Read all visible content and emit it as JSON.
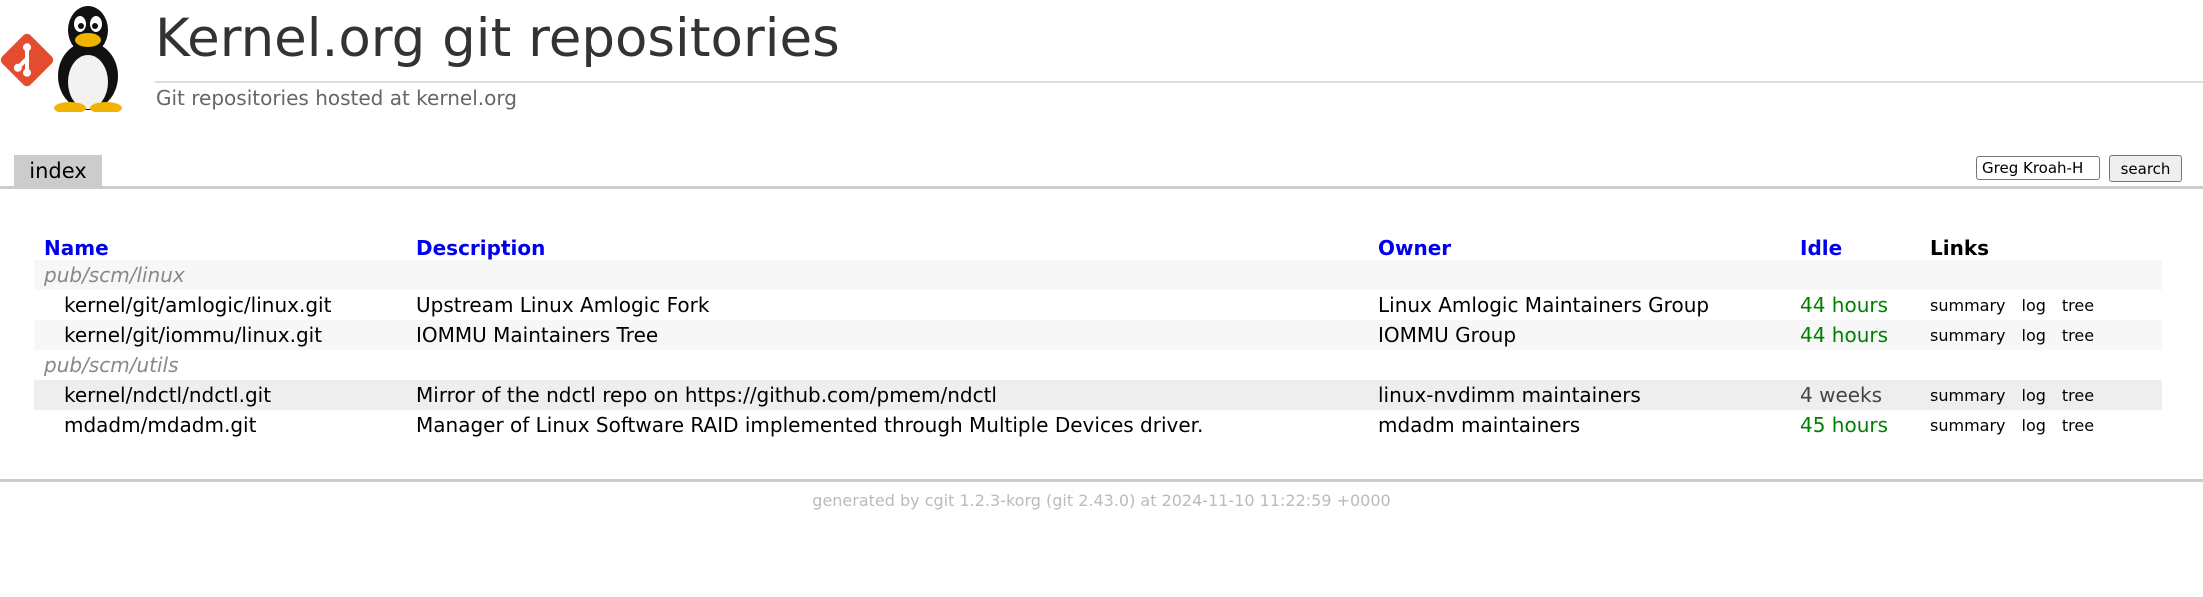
{
  "header": {
    "title": "Kernel.org git repositories",
    "subtitle": "Git repositories hosted at kernel.org",
    "logo_icon": "tux-git-logo-icon"
  },
  "tabs": [
    {
      "label": "index",
      "active": true
    }
  ],
  "search": {
    "value": "Greg Kroah-H",
    "button_label": "search"
  },
  "table": {
    "columns": {
      "name": "Name",
      "description": "Description",
      "owner": "Owner",
      "idle": "Idle",
      "links": "Links"
    },
    "sections": [
      {
        "label": "pub/scm/linux",
        "repos": [
          {
            "name": "kernel/git/amlogic/linux.git",
            "description": "Upstream Linux Amlogic Fork",
            "owner": "Linux Amlogic Maintainers Group",
            "idle": "44 hours"
          },
          {
            "name": "kernel/git/iommu/linux.git",
            "description": "IOMMU Maintainers Tree",
            "owner": "IOMMU Group",
            "idle": "44 hours"
          }
        ]
      },
      {
        "label": "pub/scm/utils",
        "repos": [
          {
            "name": "kernel/ndctl/ndctl.git",
            "description": "Mirror of the ndctl repo on https://github.com/pmem/ndctl",
            "owner": "linux-nvdimm maintainers",
            "idle": "4 weeks"
          },
          {
            "name": "mdadm/mdadm.git",
            "description": "Manager of Linux Software RAID implemented through Multiple Devices driver.",
            "owner": "mdadm maintainers",
            "idle": "45 hours"
          }
        ]
      }
    ],
    "link_labels": {
      "summary": "summary",
      "log": "log",
      "tree": "tree"
    }
  },
  "footer": {
    "text": "generated by cgit 1.2.3-korg (git 2.43.0) at 2024-11-10 11:22:59 +0000"
  },
  "colors": {
    "link": "#0000ee",
    "age_recent": "#008000",
    "section_text": "#888888",
    "tab_bg": "#cccccc"
  }
}
